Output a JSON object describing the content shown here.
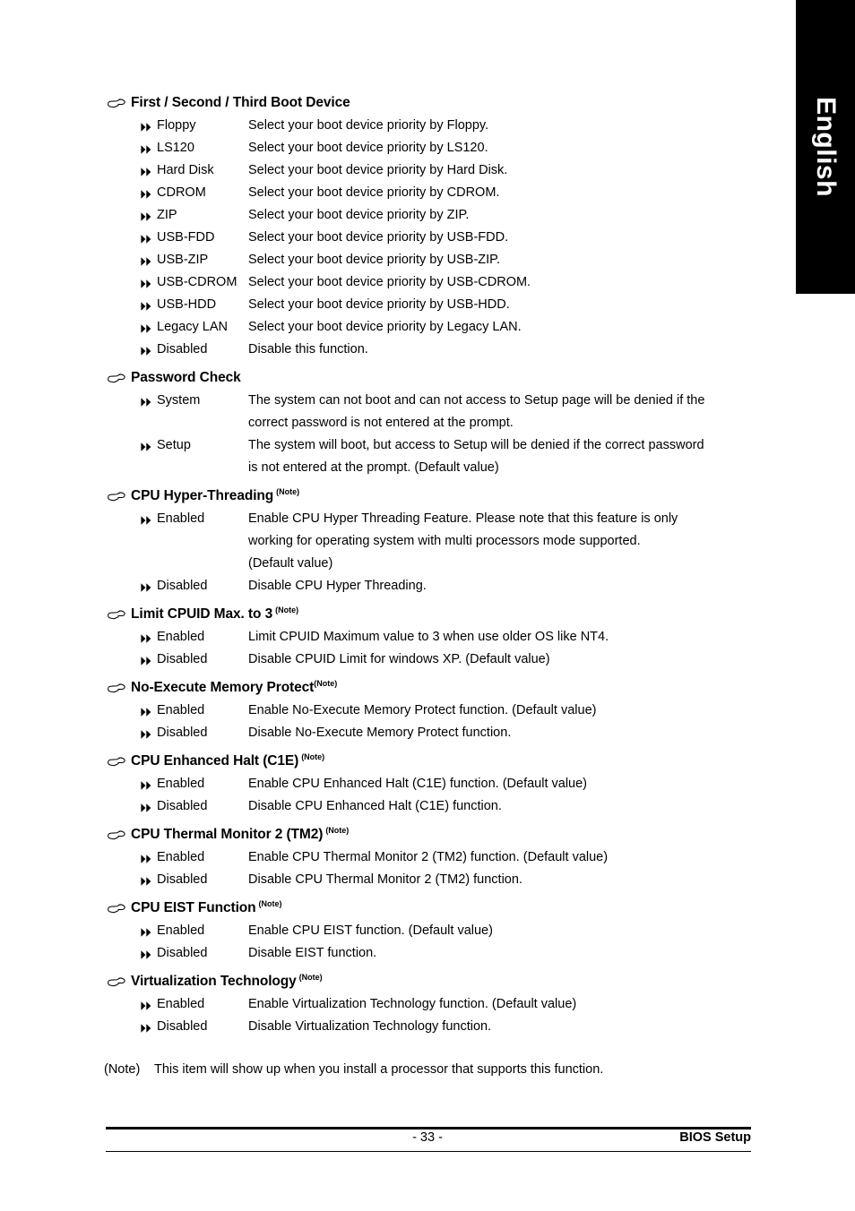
{
  "language_tab": {
    "label": "English"
  },
  "sections": [
    {
      "id": "first-second-third-boot-device",
      "title": "First / Second / Third Boot Device",
      "note": "",
      "options": [
        {
          "label": "Floppy",
          "lines": [
            "Select your boot device priority by Floppy."
          ]
        },
        {
          "label": "LS120",
          "lines": [
            "Select your boot device priority by LS120."
          ]
        },
        {
          "label": "Hard Disk",
          "lines": [
            "Select your boot device priority by Hard Disk."
          ]
        },
        {
          "label": "CDROM",
          "lines": [
            "Select your boot device priority by CDROM."
          ]
        },
        {
          "label": "ZIP",
          "lines": [
            "Select your boot device priority by ZIP."
          ]
        },
        {
          "label": "USB-FDD",
          "lines": [
            "Select your boot device priority by USB-FDD."
          ]
        },
        {
          "label": "USB-ZIP",
          "lines": [
            "Select your boot device priority by USB-ZIP."
          ]
        },
        {
          "label": "USB-CDROM",
          "lines": [
            "Select your boot device priority by USB-CDROM."
          ]
        },
        {
          "label": "USB-HDD",
          "lines": [
            "Select your boot device priority by USB-HDD."
          ]
        },
        {
          "label": "Legacy LAN",
          "lines": [
            "Select your boot device priority by Legacy LAN."
          ]
        },
        {
          "label": "Disabled",
          "lines": [
            "Disable this function."
          ]
        }
      ]
    },
    {
      "id": "password-check",
      "title": "Password Check",
      "note": "",
      "options": [
        {
          "label": "System",
          "lines": [
            "The system can not boot and can not access to Setup page will be denied if the",
            "correct password is not entered at the prompt."
          ]
        },
        {
          "label": "Setup",
          "lines": [
            "The system will boot, but access to Setup will be denied if the correct password",
            "is not entered at the prompt. (Default value)"
          ]
        }
      ]
    },
    {
      "id": "cpu-hyper-threading",
      "title": "CPU Hyper-Threading",
      "note": "(Note)",
      "note_spaced": true,
      "options": [
        {
          "label": "Enabled",
          "lines": [
            "Enable CPU Hyper Threading Feature. Please note that this feature is only",
            "working for operating system with multi processors mode supported.",
            "(Default value)"
          ]
        },
        {
          "label": "Disabled",
          "lines": [
            "Disable CPU Hyper Threading."
          ]
        }
      ]
    },
    {
      "id": "limit-cpuid-max-to-3",
      "title": "Limit CPUID Max. to 3",
      "note": "(Note)",
      "note_spaced": true,
      "options": [
        {
          "label": "Enabled",
          "lines": [
            "Limit CPUID Maximum value to 3 when use older OS like NT4."
          ]
        },
        {
          "label": "Disabled",
          "lines": [
            "Disable CPUID Limit for windows XP. (Default value)"
          ]
        }
      ]
    },
    {
      "id": "no-execute-memory-protect",
      "title": "No-Execute Memory Protect",
      "note": "(Note)",
      "note_spaced": false,
      "options": [
        {
          "label": "Enabled",
          "lines": [
            "Enable No-Execute Memory Protect function. (Default value)"
          ]
        },
        {
          "label": "Disabled",
          "lines": [
            "Disable No-Execute Memory Protect function."
          ]
        }
      ]
    },
    {
      "id": "cpu-enhanced-halt-c1e",
      "title": "CPU Enhanced Halt (C1E)",
      "note": "(Note)",
      "note_spaced": true,
      "options": [
        {
          "label": "Enabled",
          "lines": [
            "Enable CPU Enhanced Halt (C1E) function. (Default value)"
          ]
        },
        {
          "label": "Disabled",
          "lines": [
            "Disable CPU Enhanced Halt (C1E) function."
          ]
        }
      ]
    },
    {
      "id": "cpu-thermal-monitor-2-tm2",
      "title": "CPU Thermal Monitor 2 (TM2)",
      "note": "(Note)",
      "note_spaced": true,
      "options": [
        {
          "label": "Enabled",
          "lines": [
            "Enable CPU Thermal Monitor 2 (TM2) function. (Default value)"
          ]
        },
        {
          "label": "Disabled",
          "lines": [
            "Disable CPU Thermal Monitor 2 (TM2) function."
          ]
        }
      ]
    },
    {
      "id": "cpu-eist-function",
      "title": "CPU EIST Function",
      "note": "(Note)",
      "note_spaced": true,
      "options": [
        {
          "label": "Enabled",
          "lines": [
            "Enable CPU EIST function. (Default value)"
          ]
        },
        {
          "label": "Disabled",
          "lines": [
            "Disable EIST function."
          ]
        }
      ]
    },
    {
      "id": "virtualization-technology",
      "title": "Virtualization Technology",
      "note": "(Note)",
      "note_spaced": true,
      "options": [
        {
          "label": "Enabled",
          "lines": [
            "Enable Virtualization Technology function. (Default value)"
          ]
        },
        {
          "label": "Disabled",
          "lines": [
            "Disable Virtualization Technology function."
          ]
        }
      ]
    }
  ],
  "footnote": {
    "marker": "(Note)",
    "text": "This item will show up when you install a processor that supports this function."
  },
  "footer": {
    "page_number": "- 33 -",
    "section_label": "BIOS Setup"
  },
  "colors": {
    "tab_background": "#000000",
    "tab_text": "#ffffff",
    "body_text": "#000000",
    "page_background": "#ffffff"
  }
}
